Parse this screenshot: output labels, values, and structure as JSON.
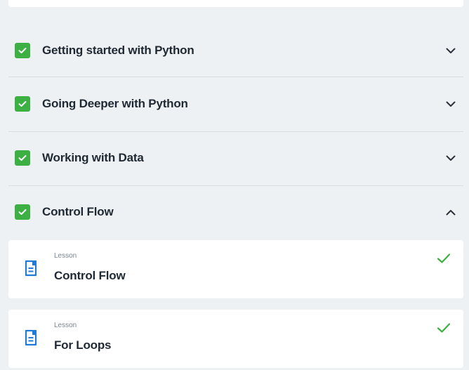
{
  "sections": [
    {
      "title": "Getting started with Python",
      "completed": true,
      "expanded": false
    },
    {
      "title": "Going Deeper with Python",
      "completed": true,
      "expanded": false
    },
    {
      "title": "Working with Data",
      "completed": true,
      "expanded": false
    },
    {
      "title": "Control Flow",
      "completed": true,
      "expanded": true
    }
  ],
  "lessons": [
    {
      "kind": "Lesson",
      "title": "Control Flow",
      "completed": true
    },
    {
      "kind": "Lesson",
      "title": "For Loops",
      "completed": true
    }
  ],
  "colors": {
    "check_green": "#3cb043",
    "doc_blue": "#1f7ad8",
    "background": "#eef1f4"
  },
  "icons": {
    "section_status": "checkbox-checked-icon",
    "collapsed": "chevron-down-icon",
    "expanded": "chevron-up-icon",
    "lesson": "document-icon",
    "lesson_done": "checkmark-icon"
  }
}
